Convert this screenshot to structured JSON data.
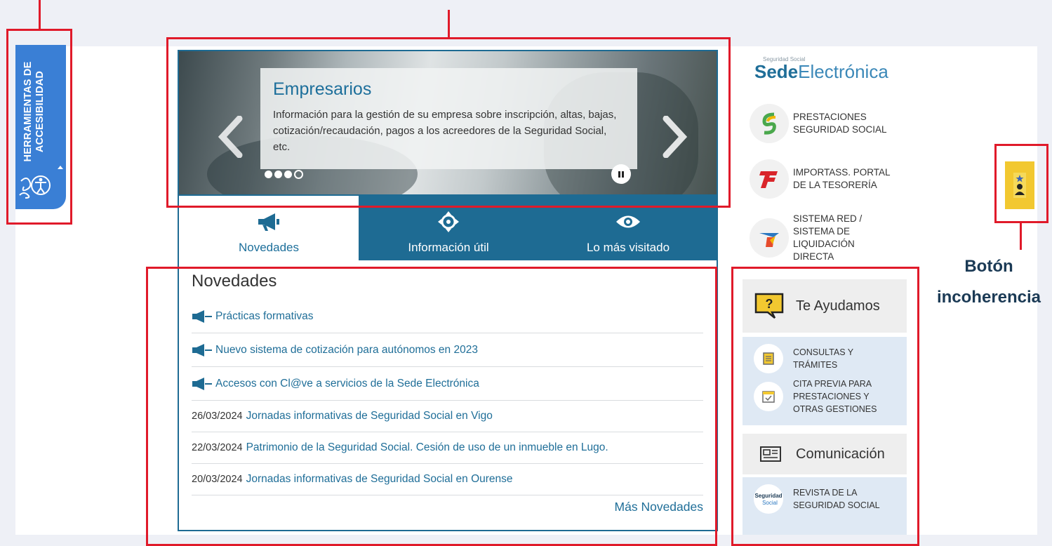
{
  "accessibility": {
    "line1": "HERRAMIENTAS DE",
    "line2": "ACCESIBILIDAD",
    "icon": "accessibility-icon"
  },
  "carousel": {
    "title": "Empresarios",
    "text": "Información para la gestión de su empresa sobre inscripción, altas, bajas, cotización/recaudación, pagos a los acreedores de la Seguridad Social, etc.",
    "slides_total": 4,
    "active_slide": 4
  },
  "tabs": [
    {
      "label": "Novedades",
      "icon": "megaphone-icon",
      "active": true
    },
    {
      "label": "Información útil",
      "icon": "crosshair-icon",
      "active": false
    },
    {
      "label": "Lo más visitado",
      "icon": "eye-icon",
      "active": false
    }
  ],
  "news": {
    "heading": "Novedades",
    "featured": [
      {
        "text": "Prácticas formativas"
      },
      {
        "text": "Nuevo sistema de cotización para autónomos en 2023"
      },
      {
        "text": "Accesos con Cl@ve a servicios de la Sede Electrónica"
      }
    ],
    "items": [
      {
        "date": "26/03/2024",
        "text": "Jornadas informativas de Seguridad Social en Vigo"
      },
      {
        "date": "22/03/2024",
        "text": "Patrimonio de la Seguridad Social. Cesión de uso de un inmueble en Lugo."
      },
      {
        "date": "20/03/2024",
        "text": "Jornadas informativas de Seguridad Social en Ourense"
      }
    ],
    "more": "Más Novedades"
  },
  "logo": {
    "small": "Seguridad Social",
    "bold": "Sede",
    "light": "Electrónica"
  },
  "services": [
    {
      "line1": "PRESTACIONES",
      "line2": "SEGURIDAD SOCIAL",
      "icon": "prestaciones-icon"
    },
    {
      "line1": "IMPORTASS. PORTAL",
      "line2": "DE LA TESORERÍA",
      "icon": "importass-icon"
    },
    {
      "line1": "SISTEMA RED /",
      "line2": "SISTEMA DE",
      "line3": "LIQUIDACIÓN",
      "line4": "DIRECTA",
      "icon": "sistema-red-icon"
    }
  ],
  "help": {
    "title": "Te Ayudamos",
    "items": [
      {
        "line1": "CONSULTAS Y",
        "line2": "TRÁMITES",
        "icon": "document-icon"
      },
      {
        "line1": "CITA PREVIA PARA",
        "line2": "PRESTACIONES Y",
        "line3": "OTRAS GESTIONES",
        "icon": "calendar-icon"
      }
    ]
  },
  "communication": {
    "title": "Comunicación",
    "items": [
      {
        "line1": "REVISTA DE LA",
        "line2": "SEGURIDAD SOCIAL",
        "icon": "revista-icon",
        "logo_top": "Seguridad",
        "logo_bottom": "Social"
      }
    ]
  },
  "incoherence": {
    "line1": "Botón",
    "line2": "incoherencia"
  },
  "colors": {
    "accent": "#1e6b93",
    "accessibility_blue": "#3a7fd5",
    "annotation_red": "#e01a2a",
    "incoherence_yellow": "#f2c830"
  }
}
